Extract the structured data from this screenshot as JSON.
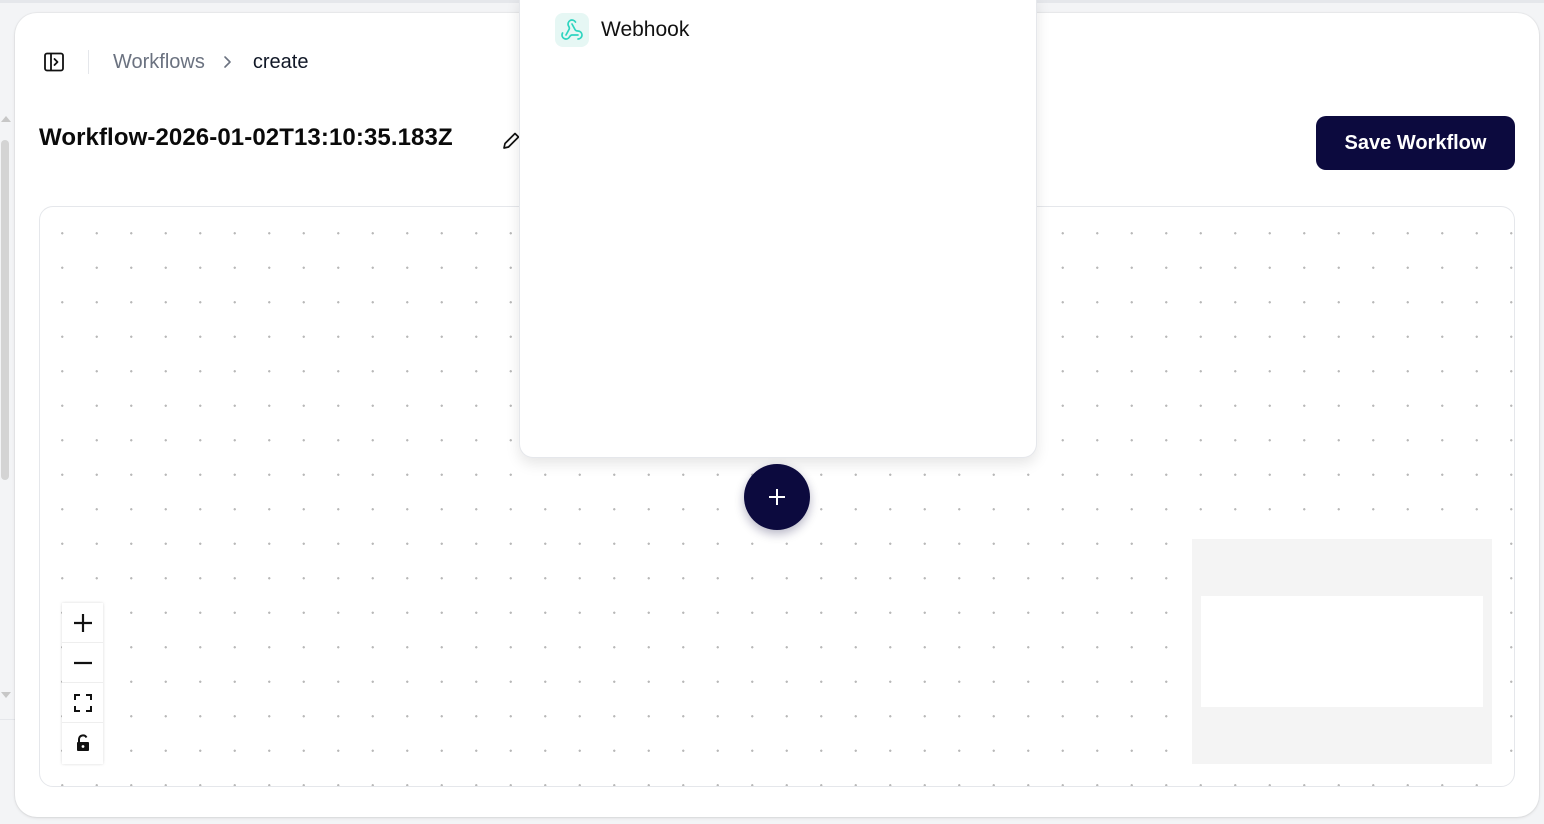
{
  "breadcrumb": {
    "items": [
      "Workflows",
      "create"
    ]
  },
  "workflow": {
    "title": "Workflow-2026-01-02T13:10:35.183Z"
  },
  "toolbar": {
    "save_label": "Save Workflow"
  },
  "trigger_panel": {
    "items": [
      {
        "label": "Webhook",
        "icon": "webhook-icon"
      }
    ]
  },
  "canvas_controls": [
    "zoom-in-icon",
    "zoom-out-icon",
    "fit-view-icon",
    "lock-icon"
  ],
  "colors": {
    "primary": "#0c0a3e",
    "webhook_accent": "#2dd4bf",
    "webhook_bg": "#e6f7f4",
    "muted_text": "#6b7280"
  }
}
